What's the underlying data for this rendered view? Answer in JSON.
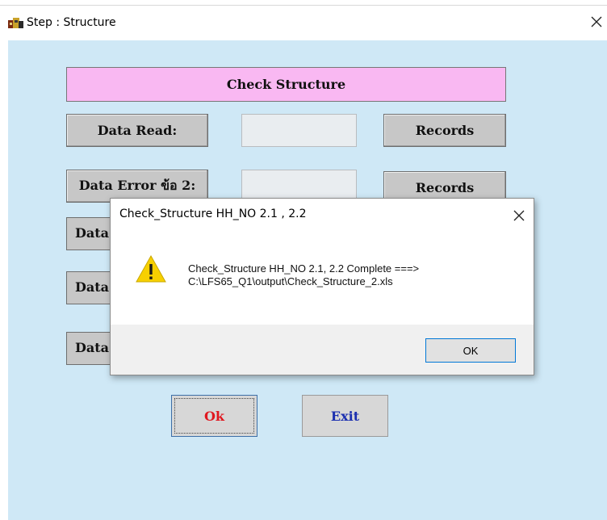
{
  "window": {
    "title": "Step : Structure"
  },
  "form": {
    "header_label": "Check Structure",
    "rows": [
      {
        "label": "Data Read:",
        "records_label": "Records",
        "value": ""
      },
      {
        "label": "Data Error ข้อ 2:",
        "records_label": "Records",
        "value": ""
      }
    ],
    "clipped_labels": [
      "Data",
      "Data",
      "Data"
    ],
    "ok_label": "Ok",
    "exit_label": "Exit"
  },
  "dialog": {
    "title": "Check_Structure HH_NO 2.1 , 2.2",
    "message_line1": "Check_Structure HH_NO 2.1, 2.2 Complete ===>",
    "message_line2": "C:\\LFS65_Q1\\output\\Check_Structure_2.xls",
    "ok_label": "OK",
    "icon": "warning-icon"
  },
  "colors": {
    "client_bg": "#cfe8f6",
    "header_bg": "#f9b8f2",
    "ok_text": "#e0171f",
    "exit_text": "#1b2fb0"
  }
}
